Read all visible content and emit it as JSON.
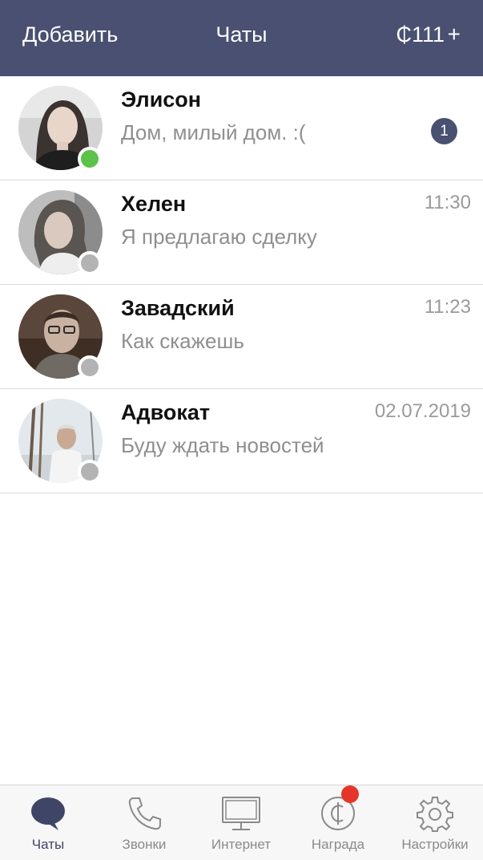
{
  "header": {
    "add_label": "Добавить",
    "title": "Чаты",
    "balance": "₵111",
    "plus": "+"
  },
  "chats": [
    {
      "name": "Элисон",
      "preview": "Дом, милый дом. :(",
      "time": "",
      "unread": "1",
      "online": true
    },
    {
      "name": "Хелен",
      "preview": "Я предлагаю сделку",
      "time": "11:30",
      "unread": "",
      "online": false
    },
    {
      "name": "Завадский",
      "preview": "Как скажешь",
      "time": "11:23",
      "unread": "",
      "online": false
    },
    {
      "name": "Адвокат",
      "preview": "Буду ждать новостей",
      "time": "02.07.2019",
      "unread": "",
      "online": false
    }
  ],
  "tabs": [
    {
      "label": "Чаты",
      "icon": "chat-bubble-icon",
      "active": true
    },
    {
      "label": "Звонки",
      "icon": "phone-icon",
      "active": false
    },
    {
      "label": "Интернет",
      "icon": "monitor-icon",
      "active": false
    },
    {
      "label": "Награда",
      "icon": "coin-icon",
      "active": false,
      "notification": true
    },
    {
      "label": "Настройки",
      "icon": "gear-icon",
      "active": false
    }
  ],
  "colors": {
    "header_bg": "#4a5071",
    "online": "#5cc24a",
    "offline": "#b3b3b3",
    "badge": "#4a5071",
    "notification": "#e5352b"
  }
}
